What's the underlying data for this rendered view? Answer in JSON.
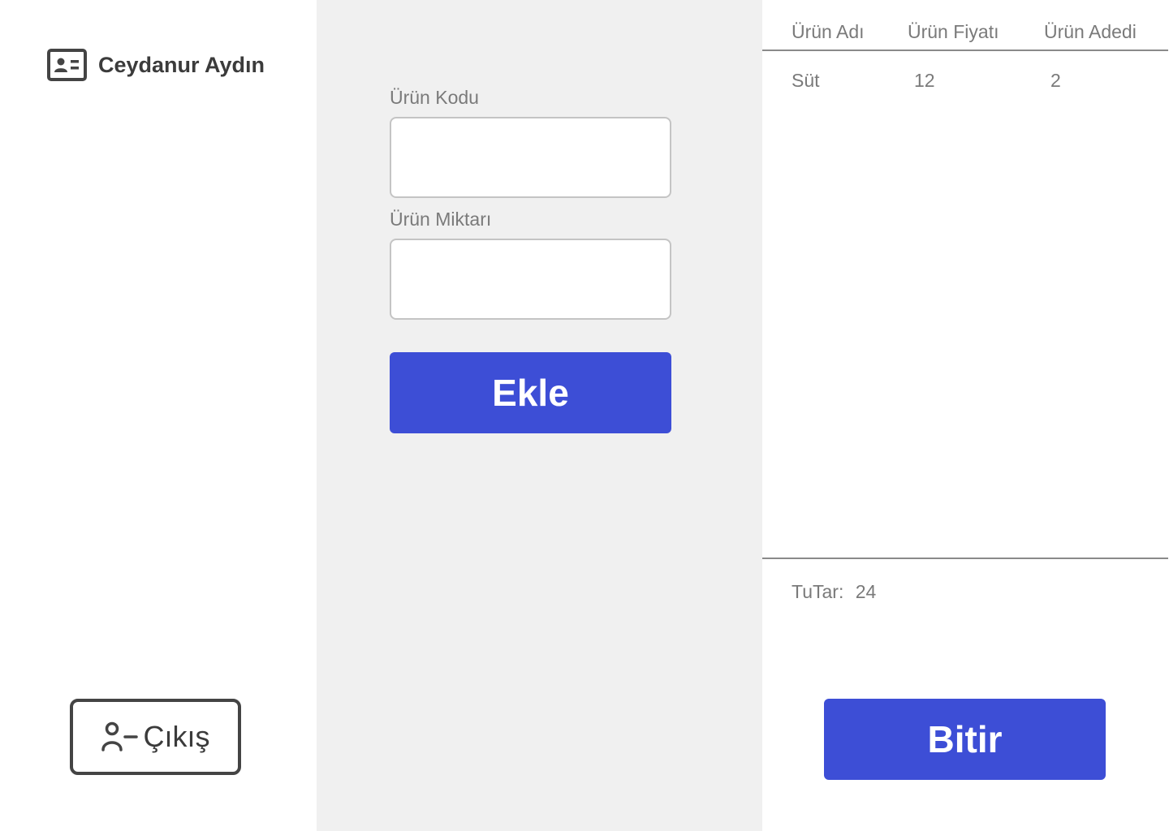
{
  "user": {
    "name": "Ceydanur Aydın",
    "icon": "id-card-icon"
  },
  "logout": {
    "label": "Çıkış",
    "icon": "user-minus-icon"
  },
  "form": {
    "product_code_label": "Ürün Kodu",
    "product_code_value": "",
    "product_quantity_label": "Ürün Miktarı",
    "product_quantity_value": "",
    "add_button_label": "Ekle"
  },
  "cart": {
    "columns": [
      "Ürün Adı",
      "Ürün Fiyatı",
      "Ürün Adedi"
    ],
    "rows": [
      {
        "name": "Süt",
        "price": "12",
        "quantity": "2"
      }
    ],
    "total_label": "TuTar:",
    "total_value": "24",
    "finish_button_label": "Bitir"
  },
  "colors": {
    "accent": "#3d4ed6",
    "form_background": "#f0f0f0",
    "text_muted": "#7a7a7a",
    "text_dark": "#3b3b3b"
  }
}
